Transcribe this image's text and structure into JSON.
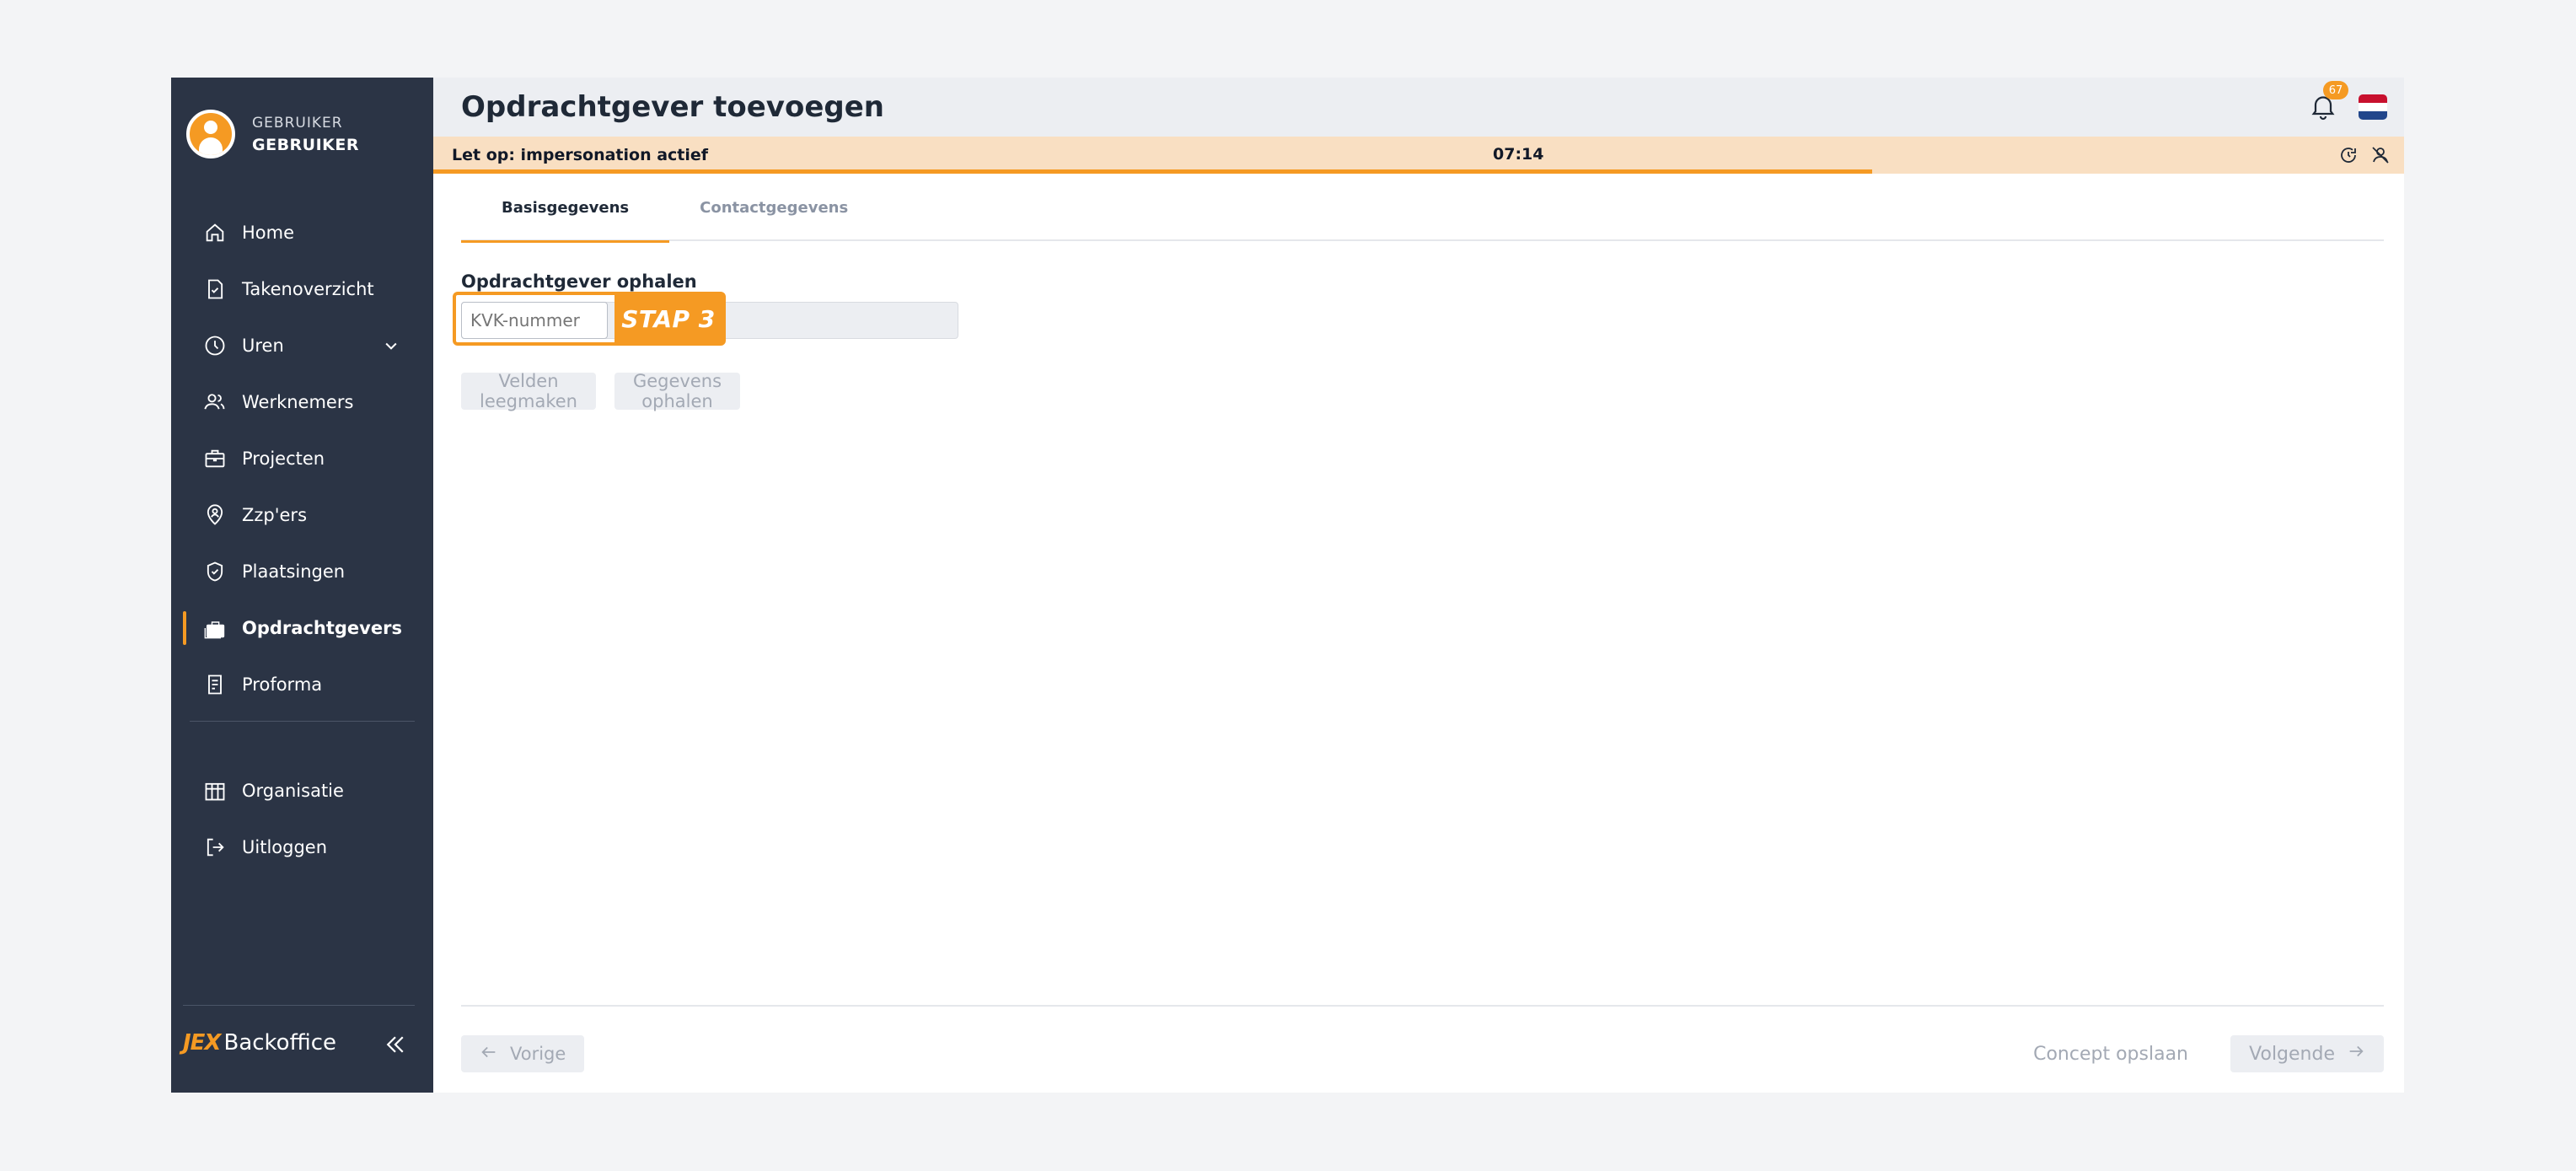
{
  "user": {
    "role": "GEBRUIKER",
    "name": "GEBRUIKER"
  },
  "nav": {
    "items": [
      {
        "label": "Home",
        "icon": "home-icon"
      },
      {
        "label": "Takenoverzicht",
        "icon": "task-icon"
      },
      {
        "label": "Uren",
        "icon": "clock-icon"
      },
      {
        "label": "Werknemers",
        "icon": "users-icon"
      },
      {
        "label": "Projecten",
        "icon": "briefcase-icon"
      },
      {
        "label": "Zzp'ers",
        "icon": "location-pin-icon"
      },
      {
        "label": "Plaatsingen",
        "icon": "shield-check-icon"
      },
      {
        "label": "Opdrachtgevers",
        "icon": "client-briefcase-icon"
      },
      {
        "label": "Proforma",
        "icon": "receipt-icon"
      }
    ],
    "secondary": [
      {
        "label": "Organisatie",
        "icon": "building-icon"
      },
      {
        "label": "Uitloggen",
        "icon": "logout-icon"
      }
    ]
  },
  "brand": {
    "mark": "JEX",
    "name": "Backoffice"
  },
  "header": {
    "title": "Opdrachtgever toevoegen",
    "notifications": "67"
  },
  "banner": {
    "text": "Let op: impersonation actief",
    "timer": "07:14",
    "progress_percent": 73
  },
  "tabs": [
    {
      "label": "Basisgegevens"
    },
    {
      "label": "Contactgegevens"
    }
  ],
  "form": {
    "section_title": "Opdrachtgever ophalen",
    "kvk_placeholder": "KVK-nummer",
    "step_label": "STAP 3",
    "clear_label": "Velden leegmaken",
    "fetch_label": "Gegevens ophalen"
  },
  "footer": {
    "prev_label": "Vorige",
    "concept_label": "Concept opslaan",
    "next_label": "Volgende"
  },
  "colors": {
    "accent": "#f59a23",
    "sidebar": "#2b3445",
    "banner": "#f9dfc2"
  }
}
